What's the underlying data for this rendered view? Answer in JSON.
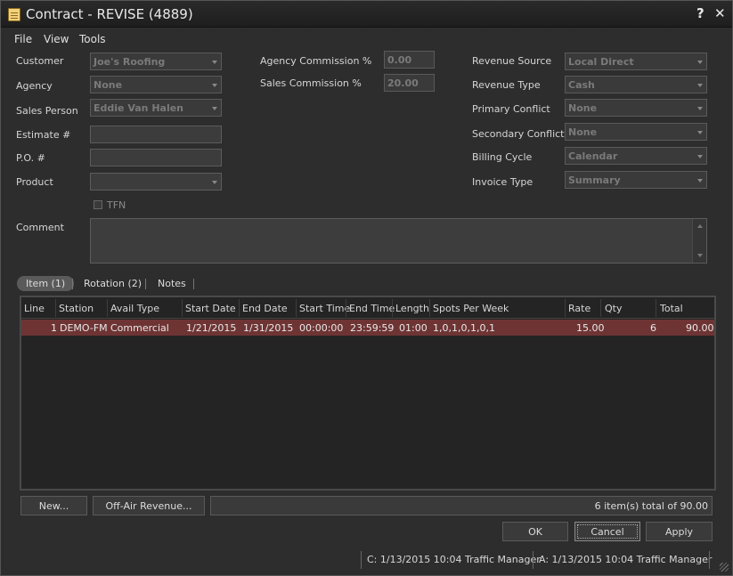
{
  "window": {
    "title": "Contract - REVISE (4889)",
    "help_label": "?",
    "close_label": "✕"
  },
  "menu": [
    "File",
    "View",
    "Tools"
  ],
  "form_left": {
    "customer_label": "Customer",
    "customer_value": "Joe's Roofing",
    "agency_label": "Agency",
    "agency_value": "None",
    "salesperson_label": "Sales Person",
    "salesperson_value": "Eddie Van Halen",
    "estimate_label": "Estimate #",
    "estimate_value": "",
    "po_label": "P.O. #",
    "po_value": "",
    "product_label": "Product",
    "product_value": "",
    "tfn_label": "TFN"
  },
  "form_middle": {
    "agency_commission_label": "Agency Commission %",
    "agency_commission_value": "0.00",
    "sales_commission_label": "Sales Commission %",
    "sales_commission_value": "20.00"
  },
  "form_right": {
    "revenue_source_label": "Revenue Source",
    "revenue_source_value": "Local Direct",
    "revenue_type_label": "Revenue Type",
    "revenue_type_value": "Cash",
    "primary_conflict_label": "Primary Conflict",
    "primary_conflict_value": "None",
    "secondary_conflict_label": "Secondary Conflict",
    "secondary_conflict_value": "None",
    "billing_cycle_label": "Billing Cycle",
    "billing_cycle_value": "Calendar",
    "invoice_type_label": "Invoice Type",
    "invoice_type_value": "Summary"
  },
  "comment": {
    "label": "Comment",
    "value": ""
  },
  "tabs": [
    "Item (1)",
    "Rotation (2)",
    "Notes"
  ],
  "grid": {
    "columns": [
      "Line",
      "Station",
      "Avail Type",
      "Start Date",
      "End Date",
      "Start Time",
      "End Time",
      "Length",
      "Spots Per Week",
      "Rate",
      "Qty",
      "Total"
    ],
    "rows": [
      [
        "1",
        "DEMO-FM",
        "Commercial",
        "1/21/2015",
        "1/31/2015",
        "00:00:00",
        "23:59:59",
        "01:00",
        "1,0,1,0,1,0,1",
        "15.00",
        "6",
        "90.00"
      ]
    ]
  },
  "actions": {
    "new_label": "New...",
    "offair_label": "Off-Air Revenue...",
    "summary": "6 item(s) total of 90.00"
  },
  "dialog_buttons": {
    "ok": "OK",
    "cancel": "Cancel",
    "apply": "Apply"
  },
  "status": {
    "created": "C: 1/13/2015 10:04 Traffic Manager",
    "altered": "A: 1/13/2015 10:04 Traffic Manager"
  }
}
